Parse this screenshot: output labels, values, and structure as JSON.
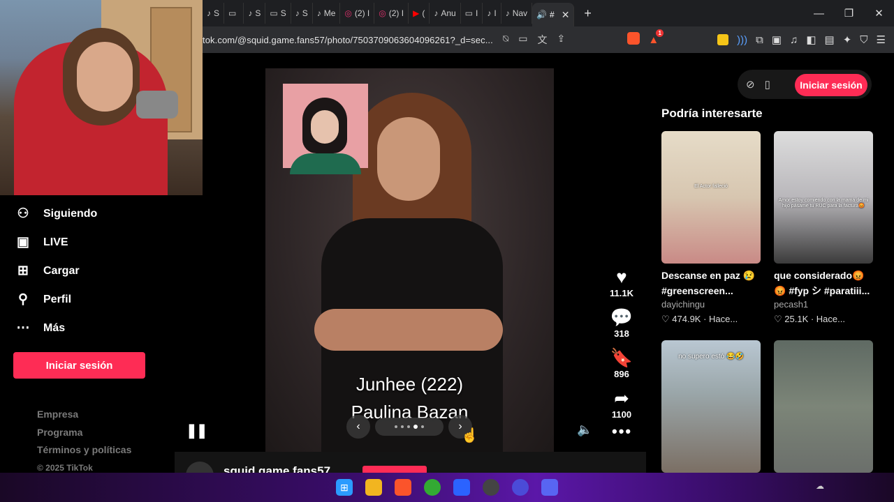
{
  "browser": {
    "tabs": [
      {
        "icon": "tiktok-icon",
        "label": "S"
      },
      {
        "icon": "window-icon",
        "label": ""
      },
      {
        "icon": "tiktok-icon",
        "label": "S"
      },
      {
        "icon": "window-icon",
        "label": "S"
      },
      {
        "icon": "tiktok-icon",
        "label": "S"
      },
      {
        "icon": "tiktok-icon",
        "label": "Me"
      },
      {
        "icon": "instagram-icon",
        "label": "(2) I"
      },
      {
        "icon": "instagram-icon",
        "label": "(2) I"
      },
      {
        "icon": "youtube-icon",
        "label": "("
      },
      {
        "icon": "tiktok-icon",
        "label": "Anu"
      },
      {
        "icon": "window-icon",
        "label": "I"
      },
      {
        "icon": "tiktok-icon",
        "label": "I"
      },
      {
        "icon": "tiktok-icon",
        "label": "Nav"
      }
    ],
    "active_tab_label": "#",
    "url": "tok.com/@squid.game.fans57/photo/7503709063604096261?_d=sec..."
  },
  "nav": {
    "items": [
      {
        "icon": "following-icon",
        "label": "Siguiendo"
      },
      {
        "icon": "live-icon",
        "label": "LIVE"
      },
      {
        "icon": "upload-icon",
        "label": "Cargar"
      },
      {
        "icon": "profile-icon",
        "label": "Perfil"
      },
      {
        "icon": "more-icon",
        "label": "Más"
      }
    ],
    "login_label": "Iniciar sesión",
    "footer": [
      "Empresa",
      "Programa",
      "Términos y políticas"
    ],
    "copyright": "© 2025 TikTok"
  },
  "post": {
    "caption_line1": "Junhee (222)",
    "caption_line2": "Paulina Bazan",
    "slide_count": 5,
    "active_slide": 4,
    "likes": "11.1K",
    "comments": "318",
    "saves": "896",
    "shares": "1100",
    "author": "squid.game.fans57"
  },
  "right": {
    "login_label": "Iniciar sesión",
    "suggest_title": "Podría interesarte",
    "cards": [
      {
        "title1": "Descanse en paz 😢",
        "title2": "#greenscreen...",
        "user": "dayichingu",
        "stats": "♡ 474.9K · Hace...",
        "overlay": "El Actor falleció"
      },
      {
        "title1": "que considerado😡",
        "title2": "😡 #fyp シ #paratiii...",
        "user": "pecash1",
        "stats": "♡ 25.1K · Hace...",
        "overlay": "Amor estoy comiendo con la mamá de mi hijo pásame tu RUC para la factura😡"
      },
      {
        "overlay": "no supero estó 😂🤣"
      },
      {
        "overlay": ""
      }
    ]
  },
  "colors": {
    "brand": "#fe2c55",
    "background": "#000000"
  }
}
